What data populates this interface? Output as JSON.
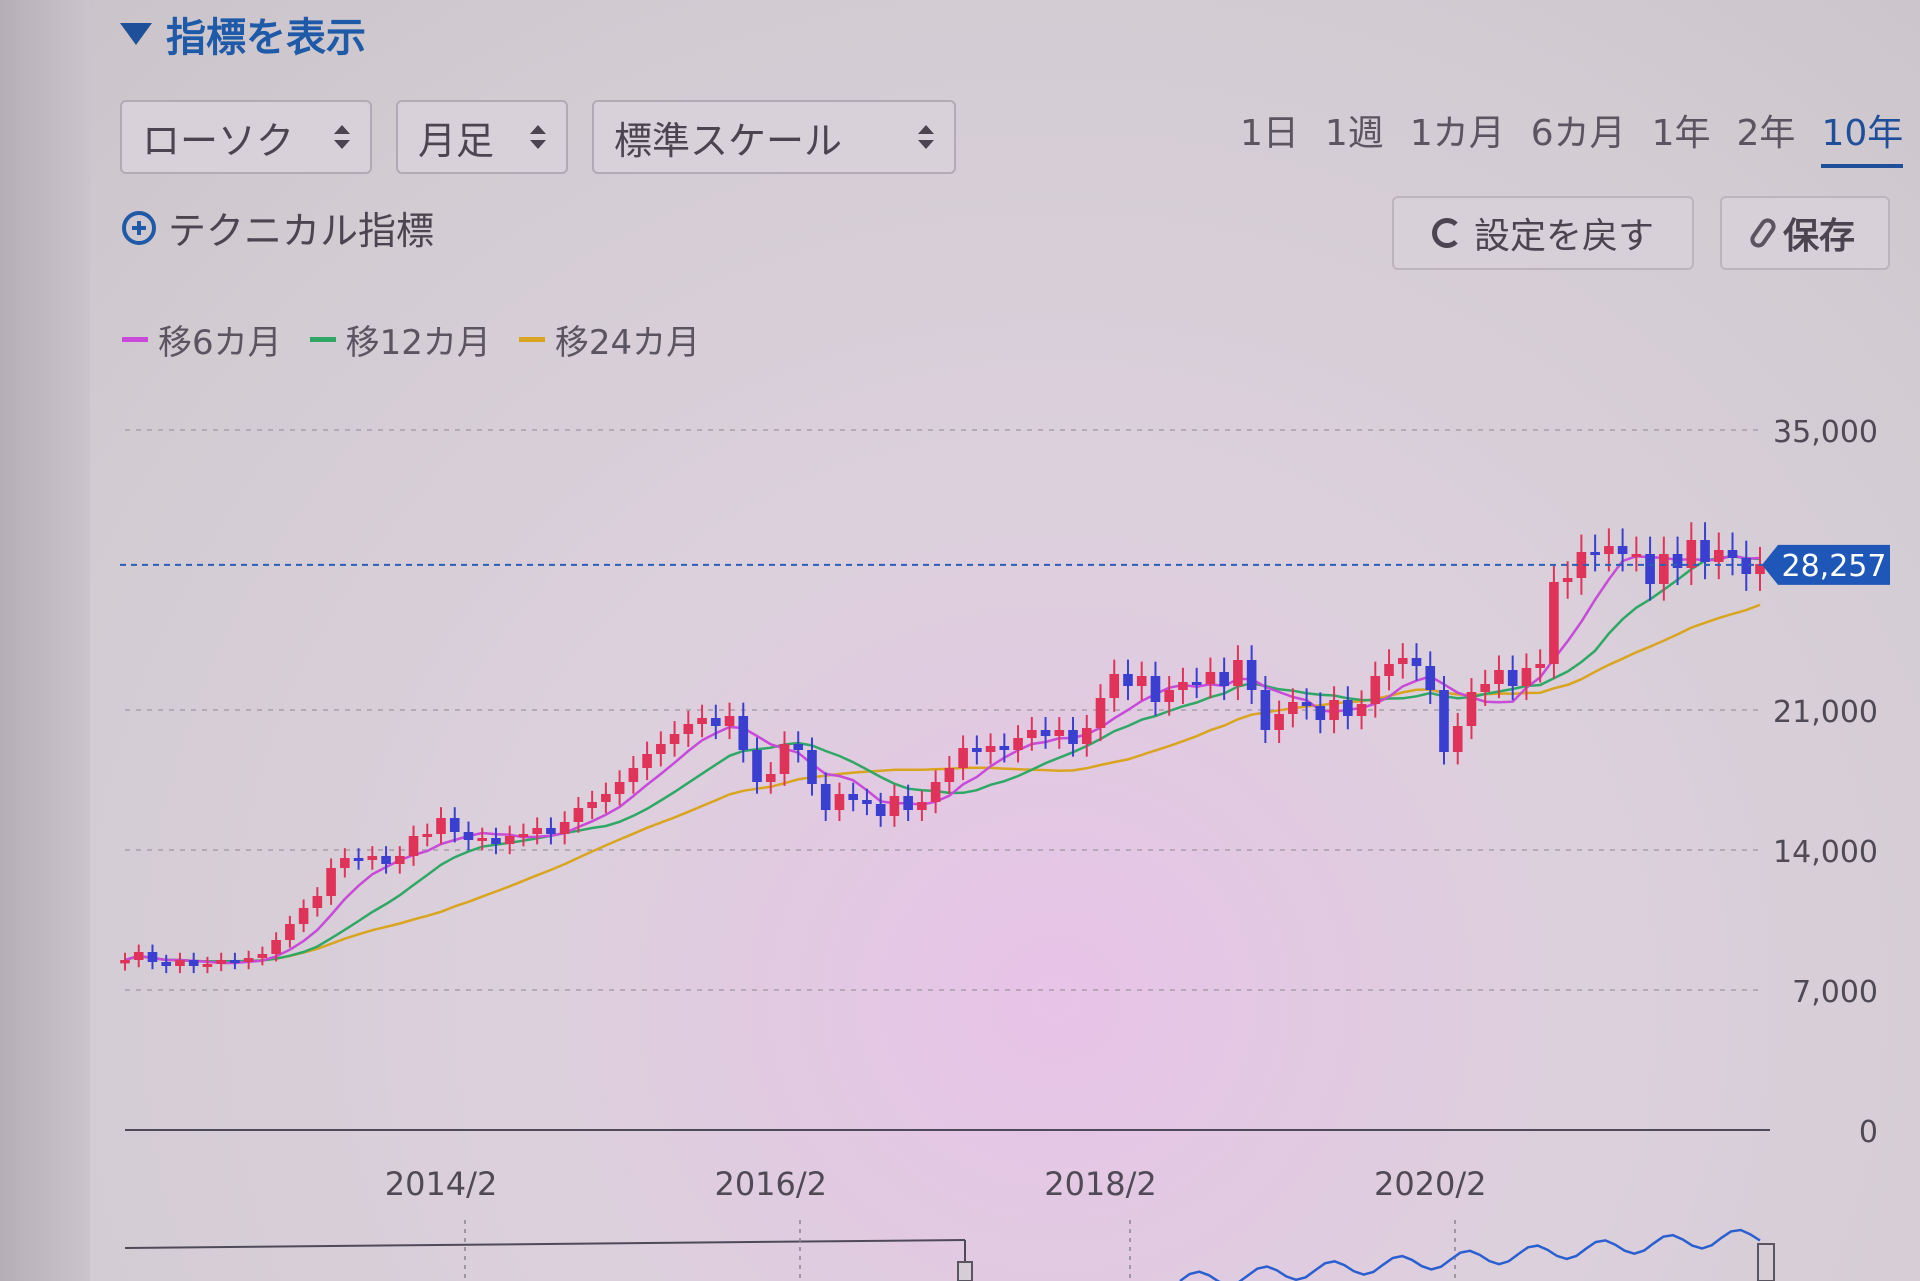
{
  "controls": {
    "toggle_label": "指標を表示",
    "selects": [
      {
        "label": "ローソク"
      },
      {
        "label": "月足"
      },
      {
        "label": "標準スケール"
      }
    ],
    "periods": [
      "1日",
      "1週",
      "1カ月",
      "6カ月",
      "1年",
      "2年",
      "10年"
    ],
    "active_period": "10年",
    "technical_label": "テクニカル指標",
    "reset_label": "設定を戻す",
    "save_label": "保存"
  },
  "colors": {
    "up": "#e0335a",
    "down": "#3a3fd0",
    "ma6": "#c74ad8",
    "ma12": "#2fa866",
    "ma24": "#d9a520",
    "accent": "#1f4f99"
  },
  "chart_data": {
    "type": "candlestick",
    "interval": "monthly",
    "legend": [
      {
        "name": "移6カ月",
        "color": "#c74ad8"
      },
      {
        "name": "移12カ月",
        "color": "#2fa866"
      },
      {
        "name": "移24カ月",
        "color": "#d9a520"
      }
    ],
    "y_ticks": [
      0,
      7000,
      14000,
      21000,
      35000
    ],
    "y_tick_labels": [
      "0",
      "7,000",
      "14,000",
      "21,000",
      "35,000"
    ],
    "ylim": [
      0,
      35000
    ],
    "x_tick_labels": [
      "2014/2",
      "2016/2",
      "2018/2",
      "2020/2"
    ],
    "x_tick_index": [
      23,
      47,
      71,
      95
    ],
    "current_price": 28257,
    "current_price_label": "28,257",
    "closes": [
      8500,
      8900,
      8400,
      8200,
      8500,
      8200,
      8300,
      8500,
      8400,
      8600,
      8800,
      9500,
      10300,
      11100,
      11700,
      13100,
      13600,
      13500,
      13700,
      13300,
      13700,
      14700,
      14800,
      15600,
      14900,
      14500,
      14600,
      14300,
      14700,
      14800,
      15100,
      14800,
      15400,
      16100,
      16400,
      16800,
      17400,
      18100,
      18800,
      19300,
      19800,
      20300,
      20600,
      20200,
      20700,
      19000,
      17400,
      17800,
      19300,
      19000,
      17300,
      16000,
      16800,
      16500,
      16300,
      15700,
      16700,
      16000,
      16400,
      17400,
      18100,
      19100,
      18900,
      19200,
      19000,
      19600,
      20000,
      19700,
      20000,
      19300,
      20100,
      21600,
      22800,
      22200,
      22700,
      21400,
      22000,
      22400,
      22300,
      22900,
      22200,
      23500,
      22000,
      20000,
      20800,
      21400,
      21200,
      20500,
      21500,
      20700,
      21300,
      22700,
      23300,
      23600,
      23200,
      22000,
      18900,
      20200,
      21900,
      22300,
      23000,
      22200,
      23100,
      23300,
      27400,
      27600,
      28900,
      28800,
      29200,
      28800,
      28800,
      27300,
      28800,
      28100,
      29500,
      28400,
      29000,
      28600,
      27800,
      28300
    ]
  }
}
